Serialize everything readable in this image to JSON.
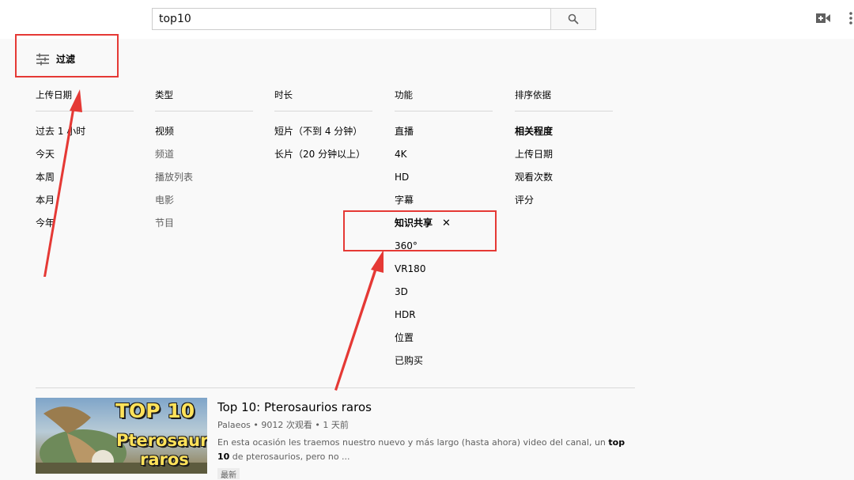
{
  "search": {
    "value": "top10"
  },
  "filter": {
    "label": "过滤"
  },
  "columns": [
    {
      "heading": "上传日期",
      "options": [
        "过去 1 小时",
        "今天",
        "本周",
        "本月",
        "今年"
      ]
    },
    {
      "heading": "类型",
      "options": [
        "视频",
        "频道",
        "播放列表",
        "电影",
        "节目"
      ]
    },
    {
      "heading": "时长",
      "options": [
        "短片（不到 4 分钟）",
        "长片（20 分钟以上）"
      ]
    },
    {
      "heading": "功能",
      "options": [
        "直播",
        "4K",
        "HD",
        "字幕",
        "知识共享",
        "360°",
        "VR180",
        "3D",
        "HDR",
        "位置",
        "已购买"
      ]
    },
    {
      "heading": "排序依据",
      "options": [
        "相关程度",
        "上传日期",
        "观看次数",
        "评分"
      ]
    }
  ],
  "active_remove": "✕",
  "video": {
    "thumb_line1": "TOP 10",
    "thumb_line2": "Pterosaurios",
    "thumb_line3": "raros",
    "title": "Top 10: Pterosaurios raros",
    "meta": "Palaeos • 9012 次观看 • 1 天前",
    "desc_pre": "En esta ocasión les traemos nuestro nuevo y más largo (hasta ahora) video del canal, un ",
    "desc_bold": "top 10",
    "desc_post": " de pterosaurios, pero no ...",
    "badge": "最新"
  },
  "colors": {
    "annotation": "#e53935",
    "accent": "#030303",
    "muted": "#606060"
  },
  "icons": [
    "search-icon",
    "video-camera-icon",
    "more-vertical-icon",
    "filter-sliders-icon"
  ]
}
